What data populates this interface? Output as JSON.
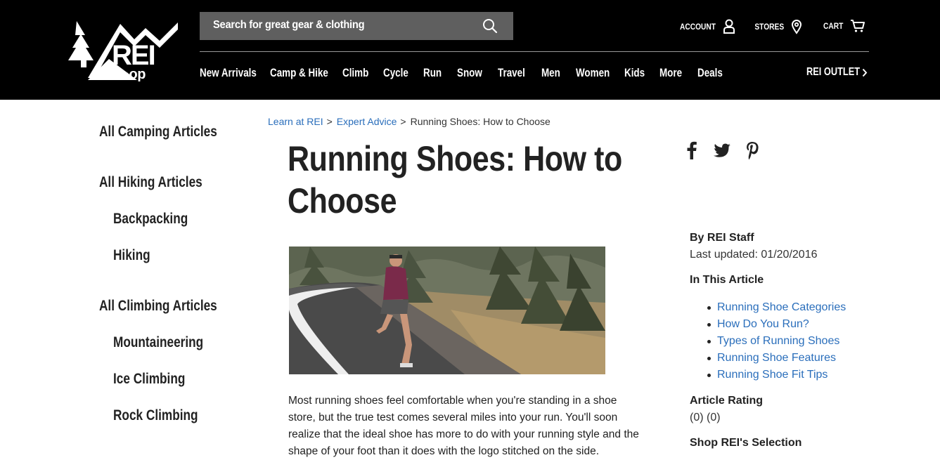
{
  "header": {
    "logo_text": "REI co-op",
    "search_placeholder": "Search for great gear & clothing",
    "account_label": "ACCOUNT",
    "stores_label": "STORES",
    "cart_label": "CART",
    "nav": [
      "New Arrivals",
      "Camp & Hike",
      "Climb",
      "Cycle",
      "Run",
      "Snow",
      "Travel",
      "Men",
      "Women",
      "Kids",
      "More",
      "Deals"
    ],
    "outlet_label": "REI OUTLET",
    "outlet_icon": "chevron-right-icon"
  },
  "sidebar": {
    "items": [
      {
        "label": "All Camping Articles",
        "level": 1
      },
      {
        "label": "All Hiking Articles",
        "level": 1
      },
      {
        "label": "Backpacking",
        "level": 2
      },
      {
        "label": "Hiking",
        "level": 2
      },
      {
        "label": "All Climbing Articles",
        "level": 1
      },
      {
        "label": "Mountaineering",
        "level": 2
      },
      {
        "label": "Ice Climbing",
        "level": 2
      },
      {
        "label": "Rock Climbing",
        "level": 2
      }
    ]
  },
  "breadcrumb": {
    "items": [
      "Learn at REI",
      "Expert Advice"
    ],
    "separator": ">",
    "current": "Running Shoes: How to Choose"
  },
  "article": {
    "title_line1": "Running Shoes: How to",
    "title_line2": "Choose",
    "intro": "Most running shoes feel comfortable when you're standing in a shoe store, but the true test comes several miles into your run. You'll soon realize that the ideal shoe has more to do with your running style and the shape of your foot than it does with the logo stitched on the side."
  },
  "social": [
    "facebook-icon",
    "twitter-icon",
    "pinterest-icon"
  ],
  "aside": {
    "author": "By REI Staff",
    "updated": "Last updated: 01/20/2016",
    "toc_title": "In This Article",
    "toc": [
      "Running Shoe Categories",
      "How Do You Run?",
      "Types of Running Shoes",
      "Running Shoe Features",
      "Running Shoe Fit Tips"
    ],
    "rating_title": "Article Rating",
    "rating_value": "(0) (0)",
    "shop_title": "Shop REI's Selection"
  },
  "colors": {
    "header_bg": "#000000",
    "search_bg": "#5f5f5f",
    "link": "#2a6ebb",
    "text": "#222222"
  }
}
